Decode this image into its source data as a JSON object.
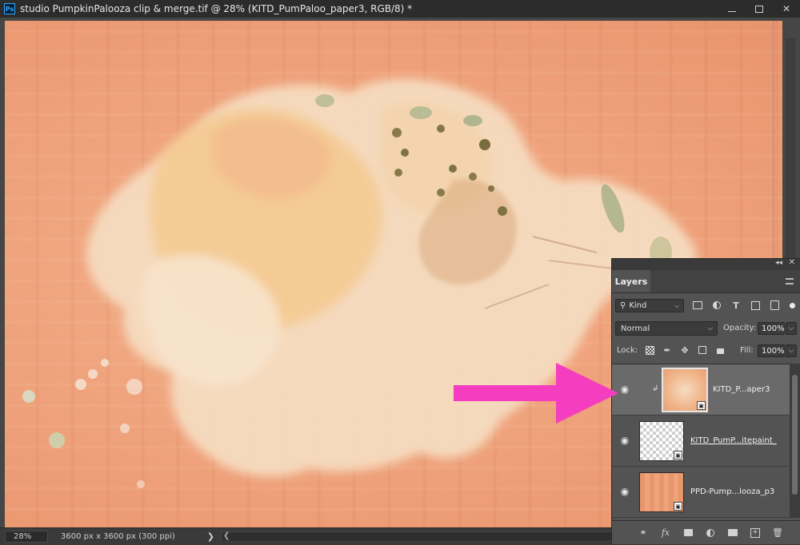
{
  "window": {
    "app_icon_label": "Ps",
    "title": "studio PumpkinPalooza clip & merge.tif @ 28% (KITD_PumPaloo_paper3, RGB/8) *",
    "controls": [
      "☐",
      "□",
      "✕"
    ]
  },
  "status": {
    "zoom": "28%",
    "doc_info": "3600 px x 3600 px (300 ppi)",
    "arrow": "❯",
    "scroll_left": "❮"
  },
  "layers_panel": {
    "tab_label": "Layers",
    "collapse": "◂◂",
    "close": "✕",
    "filter_kind": "Kind",
    "filter_icons": [
      "image-filter-icon",
      "adjustment-filter-icon",
      "type-filter-icon",
      "shape-filter-icon",
      "smart-object-filter-icon"
    ],
    "blend_mode": "Normal",
    "opacity_label": "Opacity:",
    "opacity_value": "100%",
    "lock_label": "Lock:",
    "fill_label": "Fill:",
    "fill_value": "100%",
    "layers": [
      {
        "name": "KITD_P...aper3",
        "selected": true,
        "clipped": true
      },
      {
        "name": "KITD_PumP...itepaint_",
        "selected": false,
        "clipped": false
      },
      {
        "name": "PPD-Pump...looza_p3",
        "selected": false,
        "clipped": false
      }
    ],
    "footer_icons": [
      "link-icon",
      "fx-icon",
      "mask-icon",
      "adjustment-icon",
      "folder-icon",
      "new-layer-icon",
      "trash-icon"
    ],
    "fx_label": "fx"
  },
  "colors": {
    "annotation_arrow": "#f53dbf",
    "canvas_paper": "#eea079",
    "panel_bg": "#535353"
  }
}
